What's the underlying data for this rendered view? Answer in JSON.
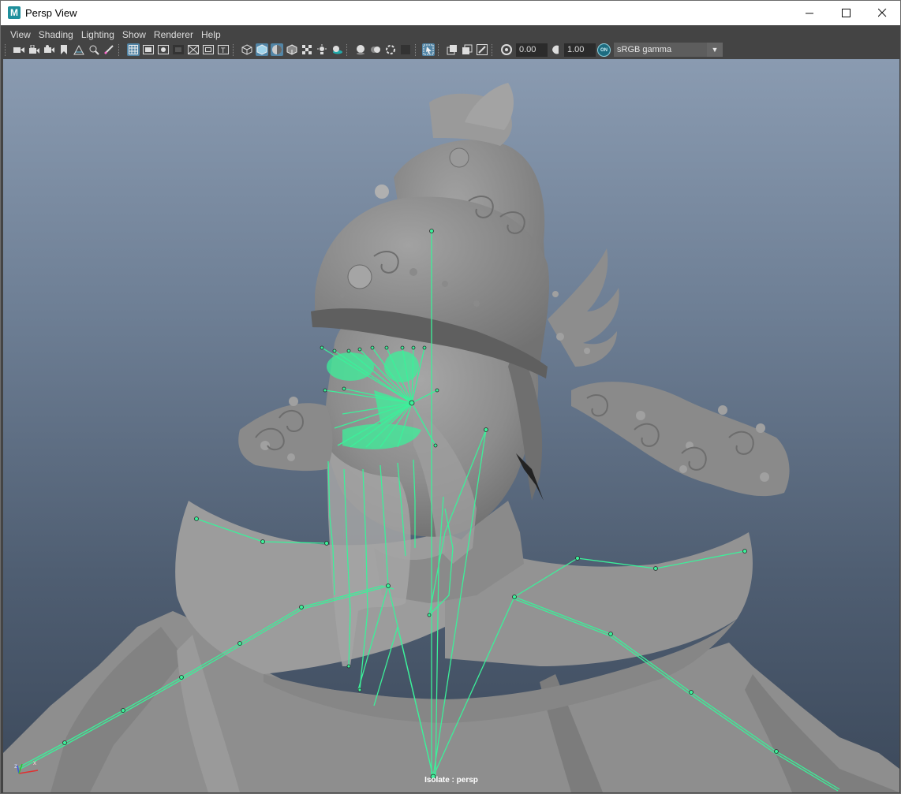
{
  "window": {
    "title": "Persp View",
    "logo_letter": "M"
  },
  "menu": [
    "View",
    "Shading",
    "Lighting",
    "Show",
    "Renderer",
    "Help"
  ],
  "toolbar": {
    "exposure": "0.00",
    "gamma": "1.00",
    "gamma_toggle": "ON",
    "color_space": "sRGB gamma"
  },
  "viewport": {
    "label": "Isolate : persp",
    "axis_labels": {
      "x": "x",
      "z": "z"
    },
    "colors": {
      "joint": "#3cf09a",
      "model": "#8c8c8c"
    }
  }
}
